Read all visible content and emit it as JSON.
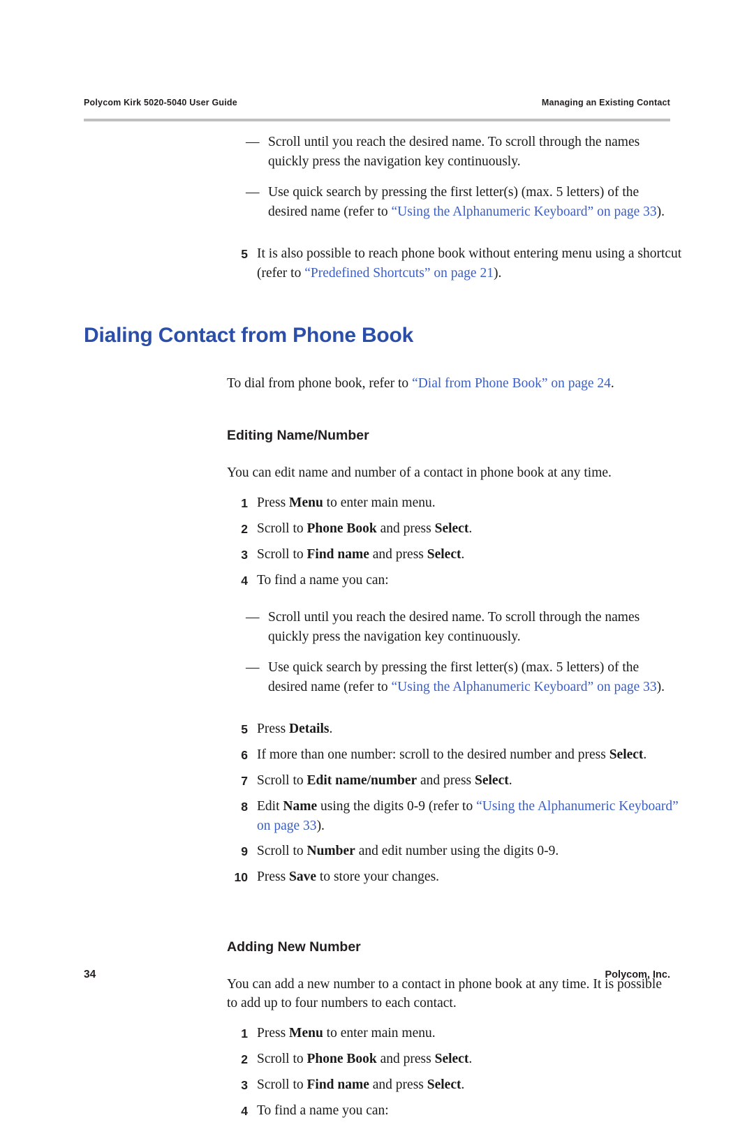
{
  "header": {
    "left": "Polycom Kirk 5020-5040 User Guide",
    "right": "Managing an Existing Contact"
  },
  "footer": {
    "page_number": "34",
    "company": "Polycom, Inc."
  },
  "blocks": {
    "top_dash_1": {
      "dash": "—",
      "text": "Scroll until you reach the desired name. To scroll through the names quickly press the navigation key continuously."
    },
    "top_dash_2": {
      "dash": "—",
      "text_a": "Use quick search by pressing the first letter(s) (max. 5 letters) of the desired name (refer to ",
      "link": "“Using the Alphanumeric Keyboard” on page 33",
      "text_b": ")."
    },
    "top_step_5": {
      "num": "5",
      "text_a": "It is also possible to reach phone book without entering menu using a shortcut (refer to ",
      "link": "“Predefined Shortcuts” on page 21",
      "text_b": ")."
    },
    "section_title": "Dialing Contact from Phone Book",
    "section_intro": {
      "text_a": "To dial from phone book, refer to ",
      "link": "“Dial from Phone Book” on page 24",
      "text_b": "."
    },
    "sub_editing": {
      "title": "Editing Name/Number",
      "intro": "You can edit name and number of a contact in phone book at any time.",
      "steps": [
        {
          "num": "1",
          "pre": "Press ",
          "bold": "Menu",
          "post": " to enter main menu."
        },
        {
          "num": "2",
          "pre": "Scroll to ",
          "bold": "Phone Book",
          "mid": " and press ",
          "bold2": "Select",
          "post": "."
        },
        {
          "num": "3",
          "pre": "Scroll to ",
          "bold": "Find name",
          "mid": " and press ",
          "bold2": "Select",
          "post": "."
        },
        {
          "num": "4",
          "pre": "To find a name you can:",
          "bold": "",
          "post": ""
        }
      ],
      "dash_1": {
        "dash": "—",
        "text": "Scroll until you reach the desired name. To scroll through the names quickly press the navigation key continuously."
      },
      "dash_2": {
        "dash": "—",
        "text_a": "Use quick search by pressing the first letter(s) (max. 5 letters) of the desired name (refer to ",
        "link": "“Using the Alphanumeric Keyboard” on page 33",
        "text_b": ")."
      },
      "steps_cont": [
        {
          "num": "5",
          "pre": "Press ",
          "bold": "Details",
          "post": "."
        },
        {
          "num": "6",
          "pre": "If more than one number: scroll to the desired number and press ",
          "bold": "Select",
          "post": "."
        },
        {
          "num": "7",
          "pre": "Scroll to ",
          "bold": "Edit name/number",
          "mid": " and press ",
          "bold2": "Select",
          "post": "."
        }
      ],
      "step_8": {
        "num": "8",
        "pre": "Edit ",
        "bold": "Name",
        "mid": " using the digits 0-9 (refer to ",
        "link": "“Using the Alphanumeric Keyboard” on page 33",
        "post": ")."
      },
      "steps_end": [
        {
          "num": "9",
          "pre": "Scroll to ",
          "bold": "Number",
          "mid": " and edit number using the digits 0-9.",
          "post": ""
        },
        {
          "num": "10",
          "pre": "Press ",
          "bold": "Save",
          "mid": " to store your changes.",
          "post": ""
        }
      ]
    },
    "sub_adding": {
      "title": "Adding New Number",
      "intro": "You can add a new number to a contact in phone book at any time. It is possible to add up to four numbers to each contact.",
      "steps": [
        {
          "num": "1",
          "pre": "Press ",
          "bold": "Menu",
          "mid": " to enter main menu.",
          "post": ""
        },
        {
          "num": "2",
          "pre": "Scroll to ",
          "bold": "Phone Book",
          "mid": " and press ",
          "bold2": "Select",
          "post": "."
        },
        {
          "num": "3",
          "pre": "Scroll to ",
          "bold": "Find name",
          "mid": " and press ",
          "bold2": "Select",
          "post": "."
        },
        {
          "num": "4",
          "pre": "To find a name you can:",
          "bold": "",
          "mid": "",
          "post": ""
        }
      ]
    }
  }
}
